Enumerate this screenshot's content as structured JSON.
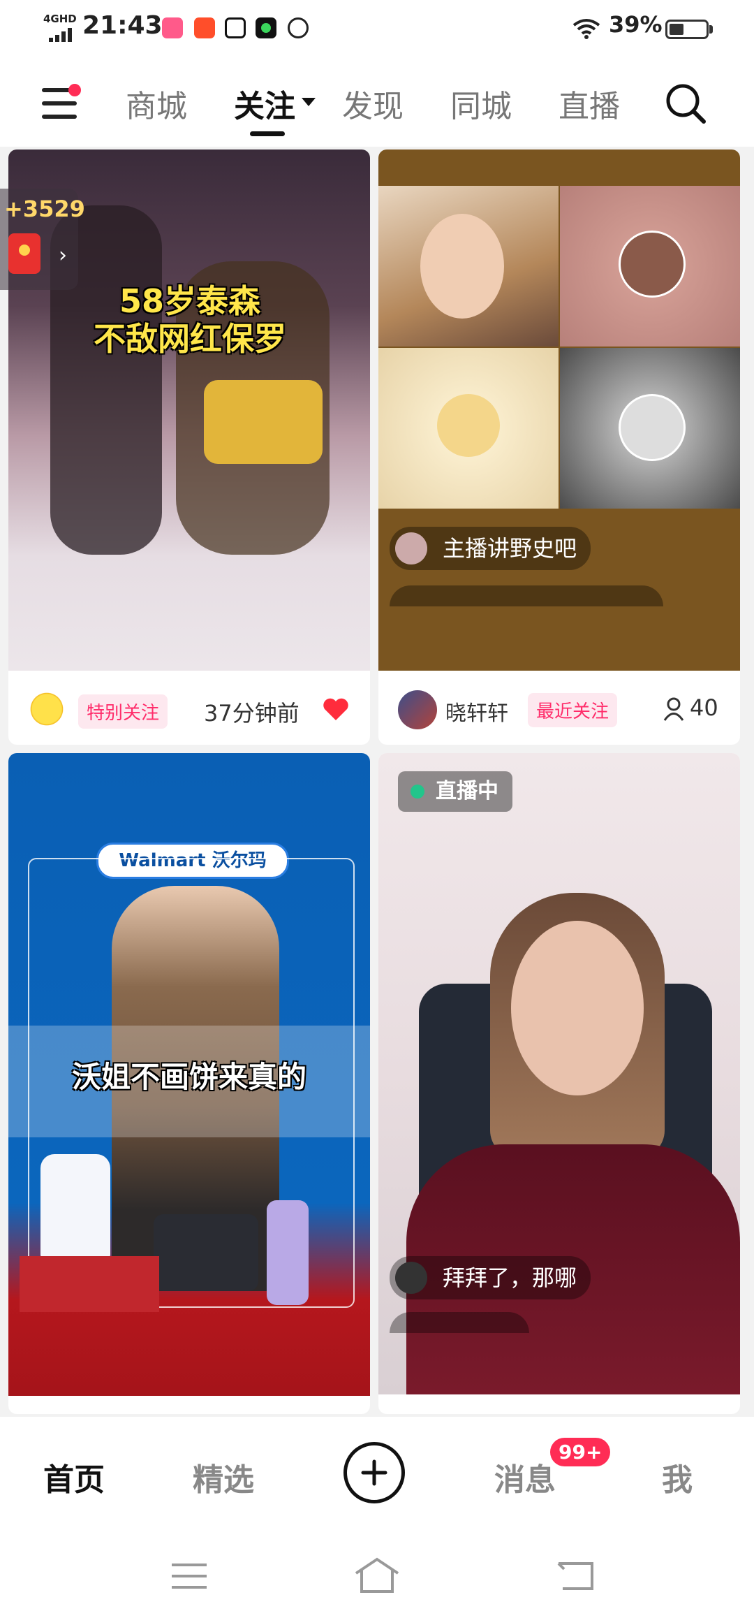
{
  "status_bar": {
    "network": "4GHD",
    "time": "21:43",
    "battery": "39%",
    "app_icons": [
      "bilibili-icon",
      "ting-icon",
      "tiktok-icon",
      "music-icon",
      "netease-icon"
    ]
  },
  "top_nav": {
    "tabs": [
      {
        "label": "商城"
      },
      {
        "label": "关注"
      },
      {
        "label": "发现"
      },
      {
        "label": "同城"
      },
      {
        "label": "直播"
      }
    ],
    "active_tab": "关注"
  },
  "feed": {
    "cards": [
      {
        "floating_badge": "+3529",
        "overlay_line1": "58岁泰森",
        "overlay_line2": "不敌网红保罗",
        "tag": "特别关注",
        "time": "37分钟前"
      },
      {
        "comment1": "主播讲野史吧",
        "author": "晓轩轩",
        "tag": "最近关注",
        "viewer_count": "40"
      },
      {
        "brand_banner": "Walmart 沃尔玛",
        "caption": "沃姐不画饼来真的"
      },
      {
        "live_label": "直播中",
        "comment1": "拜拜了，那哪"
      }
    ]
  },
  "bottom_nav": {
    "items": [
      {
        "label": "首页"
      },
      {
        "label": "精选"
      },
      {
        "label": "消息"
      },
      {
        "label": "我"
      }
    ],
    "message_badge": "99+"
  },
  "colors": {
    "accent": "#ff2c55",
    "tag_bg": "#fde8ef",
    "live_green": "#22c58b"
  }
}
